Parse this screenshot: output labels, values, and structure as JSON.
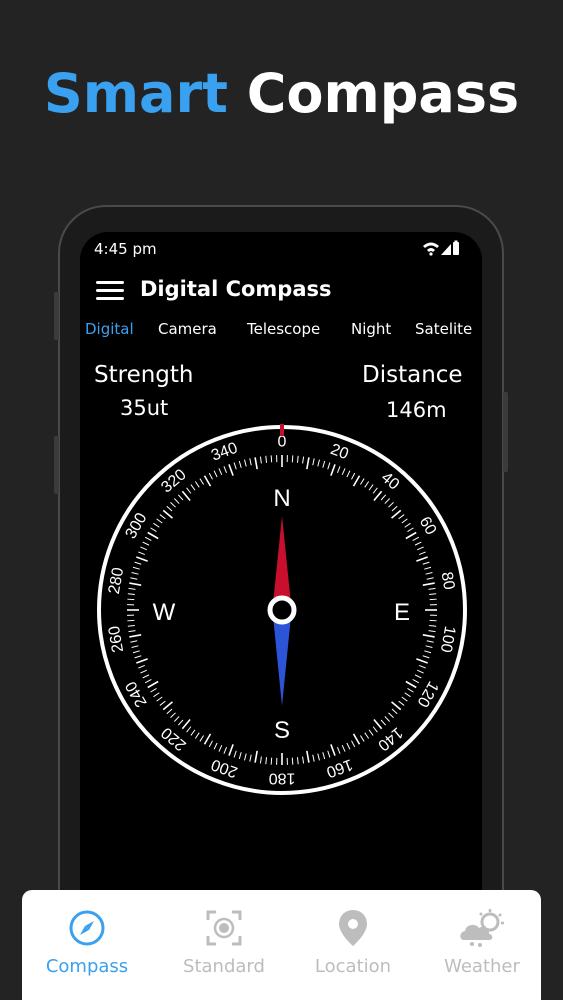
{
  "headline": {
    "word1": "Smart",
    "word2": "Compass"
  },
  "colors": {
    "accent": "#3aa0f0",
    "north": "#c8102e",
    "south": "#2b55d6"
  },
  "status_bar": {
    "time": "4:45 pm",
    "icons": [
      "wifi-icon",
      "signal-icon",
      "battery-icon"
    ]
  },
  "app_bar": {
    "title": "Digital Compass",
    "menu_icon": "hamburger-menu-icon"
  },
  "tabs": [
    {
      "label": "Digital",
      "active": true
    },
    {
      "label": "Camera",
      "active": false
    },
    {
      "label": "Telescope",
      "active": false
    },
    {
      "label": "Night",
      "active": false
    },
    {
      "label": "Satelite",
      "active": false
    }
  ],
  "strength": {
    "label": "Strength",
    "value": "35ut"
  },
  "distance": {
    "label": "Distance",
    "value": "146m"
  },
  "compass": {
    "heading_deg": 0,
    "degree_labels": [
      "0",
      "20",
      "40",
      "60",
      "80",
      "100",
      "120",
      "140",
      "160",
      "180",
      "200",
      "220",
      "240",
      "260",
      "280",
      "300",
      "320",
      "340"
    ],
    "cardinals": {
      "n": "N",
      "e": "E",
      "s": "S",
      "w": "W"
    }
  },
  "bottom_nav": [
    {
      "label": "Compass",
      "icon": "compass-icon",
      "active": true
    },
    {
      "label": "Standard",
      "icon": "focus-target-icon",
      "active": false
    },
    {
      "label": "Location",
      "icon": "location-pin-icon",
      "active": false
    },
    {
      "label": "Weather",
      "icon": "weather-cloud-sun-icon",
      "active": false
    }
  ]
}
